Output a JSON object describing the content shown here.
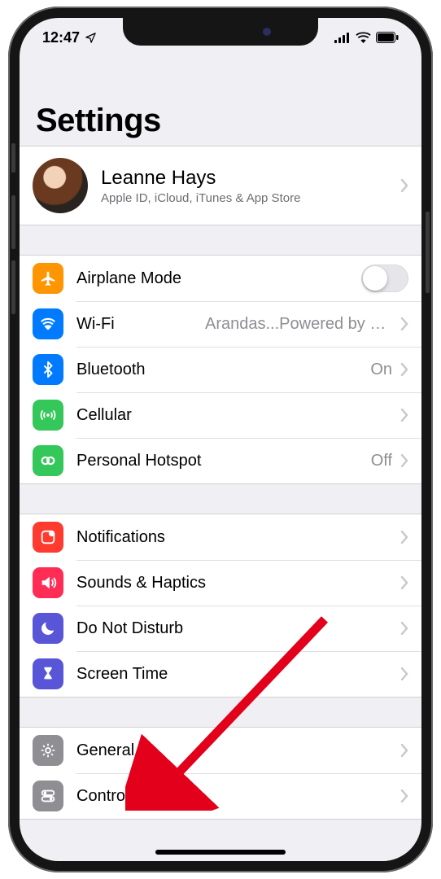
{
  "statusbar": {
    "time": "12:47"
  },
  "header": {
    "title": "Settings"
  },
  "account": {
    "name": "Leanne Hays",
    "subtitle": "Apple ID, iCloud, iTunes & App Store"
  },
  "group1": {
    "airplane": {
      "label": "Airplane Mode",
      "on": false
    },
    "wifi": {
      "label": "Wi-Fi",
      "value": "Arandas...Powered by Natel"
    },
    "bluetooth": {
      "label": "Bluetooth",
      "value": "On"
    },
    "cellular": {
      "label": "Cellular"
    },
    "hotspot": {
      "label": "Personal Hotspot",
      "value": "Off"
    }
  },
  "group2": {
    "notifications": {
      "label": "Notifications"
    },
    "sounds": {
      "label": "Sounds & Haptics"
    },
    "dnd": {
      "label": "Do Not Disturb"
    },
    "screentime": {
      "label": "Screen Time"
    }
  },
  "group3": {
    "general": {
      "label": "General"
    },
    "controlcenter": {
      "label": "Control Center"
    }
  },
  "icon_colors": {
    "airplane": "#ff9500",
    "wifi": "#007aff",
    "bluetooth": "#007aff",
    "cellular": "#34c759",
    "hotspot": "#34c759",
    "notifications": "#ff3b30",
    "sounds": "#ff2d55",
    "dnd": "#5856d6",
    "screentime": "#5856d6",
    "general": "#8e8e93",
    "controlcenter": "#8e8e93"
  }
}
